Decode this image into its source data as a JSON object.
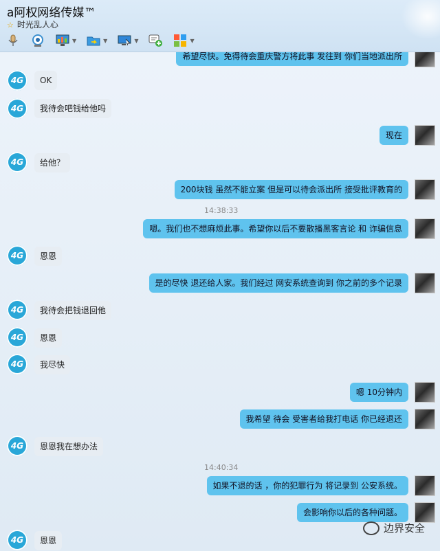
{
  "header": {
    "title": "a阿权网络传媒™",
    "status": "时光乱人心",
    "toolbar": [
      {
        "icon": "microphone-icon"
      },
      {
        "icon": "webcam-icon"
      },
      {
        "icon": "screen-share-icon"
      },
      {
        "icon": "folder-transfer-icon"
      },
      {
        "icon": "remote-desktop-icon"
      },
      {
        "icon": "add-chat-icon"
      },
      {
        "icon": "apps-grid-icon"
      }
    ]
  },
  "messages": [
    {
      "side": "out",
      "text": "希望尽快。免得待会重庆警方将此事 发往到 你们当地派出所"
    },
    {
      "side": "in",
      "text": "OK"
    },
    {
      "side": "in",
      "text": "我待会吧钱给他吗"
    },
    {
      "side": "out",
      "text": "现在"
    },
    {
      "side": "in",
      "text": "给他？"
    },
    {
      "side": "out",
      "text": "200块钱 虽然不能立案 但是可以待会派出所 接受批评教育的"
    },
    {
      "side": "time",
      "text": "14:38:33"
    },
    {
      "side": "out",
      "text": "嗯。我们也不想麻烦此事。希望你以后不要散播黑客言论 和 诈骗信息"
    },
    {
      "side": "in",
      "text": "恩恩"
    },
    {
      "side": "out",
      "text": "是的尽快 退还给人家。我们经过 网安系统查询到 你之前的多个记录"
    },
    {
      "side": "in",
      "text": "我待会把钱退回他"
    },
    {
      "side": "in",
      "text": "恩恩"
    },
    {
      "side": "in",
      "text": "我尽快"
    },
    {
      "side": "out",
      "text": "嗯 10分钟内"
    },
    {
      "side": "out",
      "text": "我希望 待会 受害者给我打电话 你已经退还"
    },
    {
      "side": "in",
      "text": "恩恩我在想办法"
    },
    {
      "side": "time",
      "text": "14:40:34"
    },
    {
      "side": "out",
      "text": "如果不退的话 ，你的犯罪行为 将记录到 公安系统。"
    },
    {
      "side": "out",
      "text": "会影响你以后的各种问题。"
    },
    {
      "side": "in",
      "text": "恩恩"
    }
  ],
  "avatar_label": "4G",
  "watermark": "边界安全",
  "colors": {
    "outgoing": "#5fc3ee",
    "incoming": "#e7edf3",
    "avatar": "#29a7d8"
  }
}
